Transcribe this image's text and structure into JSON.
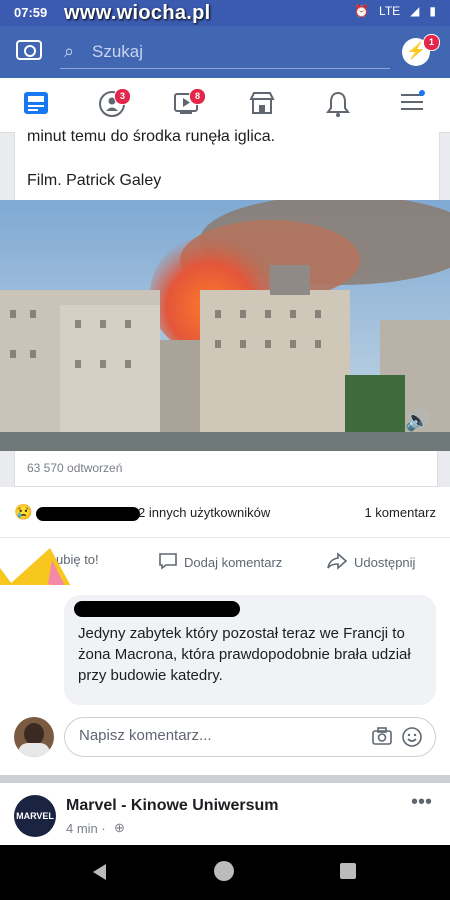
{
  "status_bar": {
    "time": "07:59",
    "network": "LTE",
    "watermark": "www.wiocha.pl"
  },
  "search": {
    "placeholder": "Szukaj"
  },
  "badges": {
    "messenger": "1",
    "groups": "3",
    "watch": "8"
  },
  "nav_icons": [
    "news-feed-icon",
    "groups-icon",
    "watch-icon",
    "marketplace-icon",
    "notifications-icon",
    "menu-icon"
  ],
  "post": {
    "text_line_1": "minut temu do środka runęła iglica.",
    "text_line_2": "Film. Patrick Galey",
    "views": "63 570 odtworzeń",
    "reactions_text": "2 innych użytkowników",
    "comments_count": "1 komentarz",
    "actions": {
      "like": "ubię to!",
      "comment": "Dodaj komentarz",
      "share": "Udostępnij"
    }
  },
  "comment": {
    "text": "Jedyny zabytek który pozostał teraz we Francji to żona Macrona, która prawdopodobnie brała udział przy budowie katedry."
  },
  "composer": {
    "placeholder": "Napisz komentarz..."
  },
  "next_post": {
    "page_name": "Marvel - Kinowe Uniwersum",
    "time": "4 min ·",
    "avatar_text": "MARVEL"
  },
  "colors": {
    "facebook_blue": "#4267b2",
    "badge_red": "#e4264a"
  }
}
